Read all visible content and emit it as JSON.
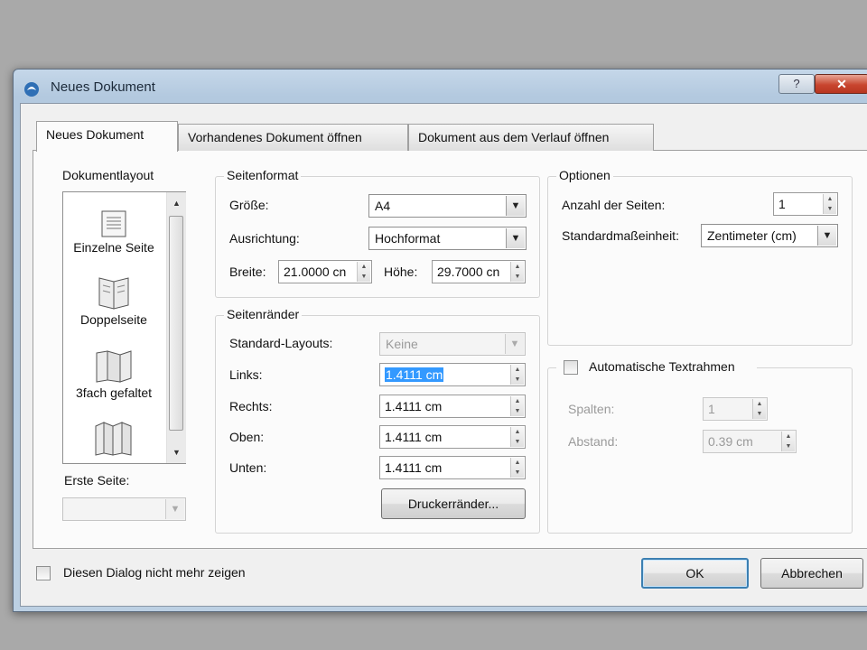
{
  "window": {
    "title": "Neues Dokument",
    "help_label": "?",
    "close_label": "✕"
  },
  "tabs": [
    {
      "label": "Neues Dokument"
    },
    {
      "label": "Vorhandenes Dokument öffnen"
    },
    {
      "label": "Dokument aus dem Verlauf öffnen"
    }
  ],
  "layout_panel": {
    "legend": "Dokumentlayout",
    "items": [
      {
        "label": "Einzelne Seite",
        "icon": "single-page-icon"
      },
      {
        "label": "Doppelseite",
        "icon": "double-page-icon"
      },
      {
        "label": "3fach gefaltet",
        "icon": "trifold-page-icon"
      },
      {
        "label": "",
        "icon": "fourfold-page-icon"
      }
    ],
    "first_page_label": "Erste Seite:",
    "first_page_value": ""
  },
  "page_format": {
    "legend": "Seitenformat",
    "size_label": "Größe:",
    "size_value": "A4",
    "orientation_label": "Ausrichtung:",
    "orientation_value": "Hochformat",
    "width_label": "Breite:",
    "width_value": "21.0000 cn",
    "height_label": "Höhe:",
    "height_value": "29.7000 cn"
  },
  "margins": {
    "legend": "Seitenränder",
    "preset_label": "Standard-Layouts:",
    "preset_value": "Keine",
    "left_label": "Links:",
    "left_value": "1.4111 cm",
    "right_label": "Rechts:",
    "right_value": "1.4111 cm",
    "top_label": "Oben:",
    "top_value": "1.4111 cm",
    "bottom_label": "Unten:",
    "bottom_value": "1.4111 cm",
    "printer_margins_button": "Druckerränder..."
  },
  "options": {
    "legend": "Optionen",
    "pages_label": "Anzahl der Seiten:",
    "pages_value": "1",
    "unit_label": "Standardmaßeinheit:",
    "unit_value": "Zentimeter (cm)"
  },
  "auto_frames": {
    "checkbox_label": "Automatische Textrahmen",
    "checked": false,
    "columns_label": "Spalten:",
    "columns_value": "1",
    "gap_label": "Abstand:",
    "gap_value": "0.39 cm"
  },
  "footer": {
    "dont_show_label": "Diesen Dialog nicht mehr zeigen",
    "ok_label": "OK",
    "cancel_label": "Abbrechen"
  },
  "colors": {
    "selection": "#3399ff",
    "default_button_border": "#3c7fb1",
    "close_button": "#c8462f"
  }
}
